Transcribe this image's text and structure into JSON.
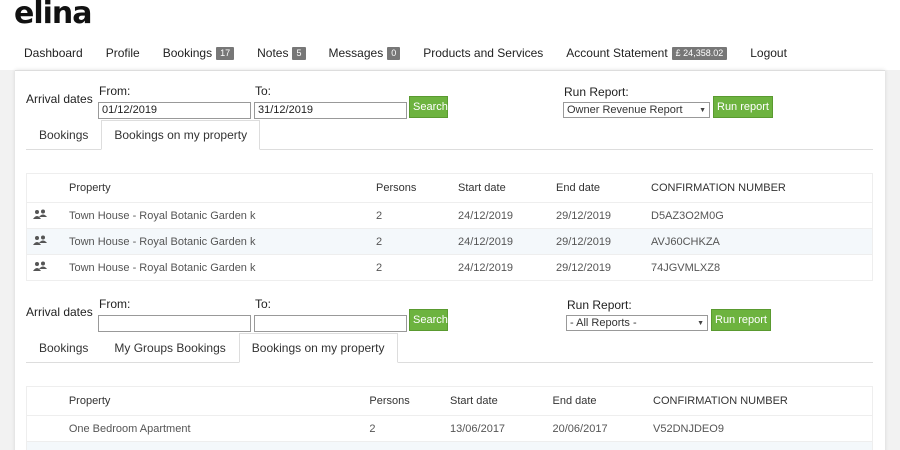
{
  "brand": "elina",
  "nav": [
    {
      "label": "Dashboard",
      "badge": null
    },
    {
      "label": "Profile",
      "badge": null
    },
    {
      "label": "Bookings",
      "badge": "17"
    },
    {
      "label": "Notes",
      "badge": "5"
    },
    {
      "label": "Messages",
      "badge": "0"
    },
    {
      "label": "Products and Services",
      "badge": null
    },
    {
      "label": "Account Statement",
      "badge": "£ 24,358.02"
    },
    {
      "label": "Logout",
      "badge": null
    }
  ],
  "section1": {
    "arrival_label": "Arrival dates",
    "from_label": "From:",
    "from_value": "01/12/2019",
    "to_label": "To:",
    "to_value": "31/12/2019",
    "search_label": "Search",
    "run_report_label": "Run Report:",
    "report_selected": "Owner Revenue Report",
    "run_report_button": "Run report",
    "tabs": [
      "Bookings",
      "Bookings on my property"
    ],
    "active_tab": 1,
    "columns": [
      "Property",
      "Persons",
      "Start date",
      "End date",
      "CONFIRMATION NUMBER"
    ],
    "rows": [
      {
        "property": "Town House - Royal Botanic Garden k",
        "persons": "2",
        "start": "24/12/2019",
        "end": "29/12/2019",
        "confirmation": "D5AZ3O2M0G"
      },
      {
        "property": "Town House - Royal Botanic Garden k",
        "persons": "2",
        "start": "24/12/2019",
        "end": "29/12/2019",
        "confirmation": "AVJ60CHKZA"
      },
      {
        "property": "Town House - Royal Botanic Garden k",
        "persons": "2",
        "start": "24/12/2019",
        "end": "29/12/2019",
        "confirmation": "74JGVMLXZ8"
      }
    ]
  },
  "section2": {
    "arrival_label": "Arrival dates",
    "from_label": "From:",
    "from_value": "",
    "to_label": "To:",
    "to_value": "",
    "search_label": "Search",
    "run_report_label": "Run Report:",
    "report_selected": "- All Reports -",
    "run_report_button": "Run report",
    "tabs": [
      "Bookings",
      "My Groups Bookings",
      "Bookings on my property"
    ],
    "active_tab": 2,
    "columns": [
      "Property",
      "Persons",
      "Start date",
      "End date",
      "CONFIRMATION NUMBER"
    ],
    "rows": [
      {
        "property": "One Bedroom Apartment",
        "persons": "2",
        "start": "13/06/2017",
        "end": "20/06/2017",
        "confirmation": "V52DNJDEO9"
      }
    ]
  },
  "colors": {
    "accent_button": "#6db33f",
    "badge": "#777777",
    "row_alt": "#f4f8fb"
  },
  "icons": {
    "row_icon": "people-icon",
    "select_icon": "chevron-down-icon"
  }
}
